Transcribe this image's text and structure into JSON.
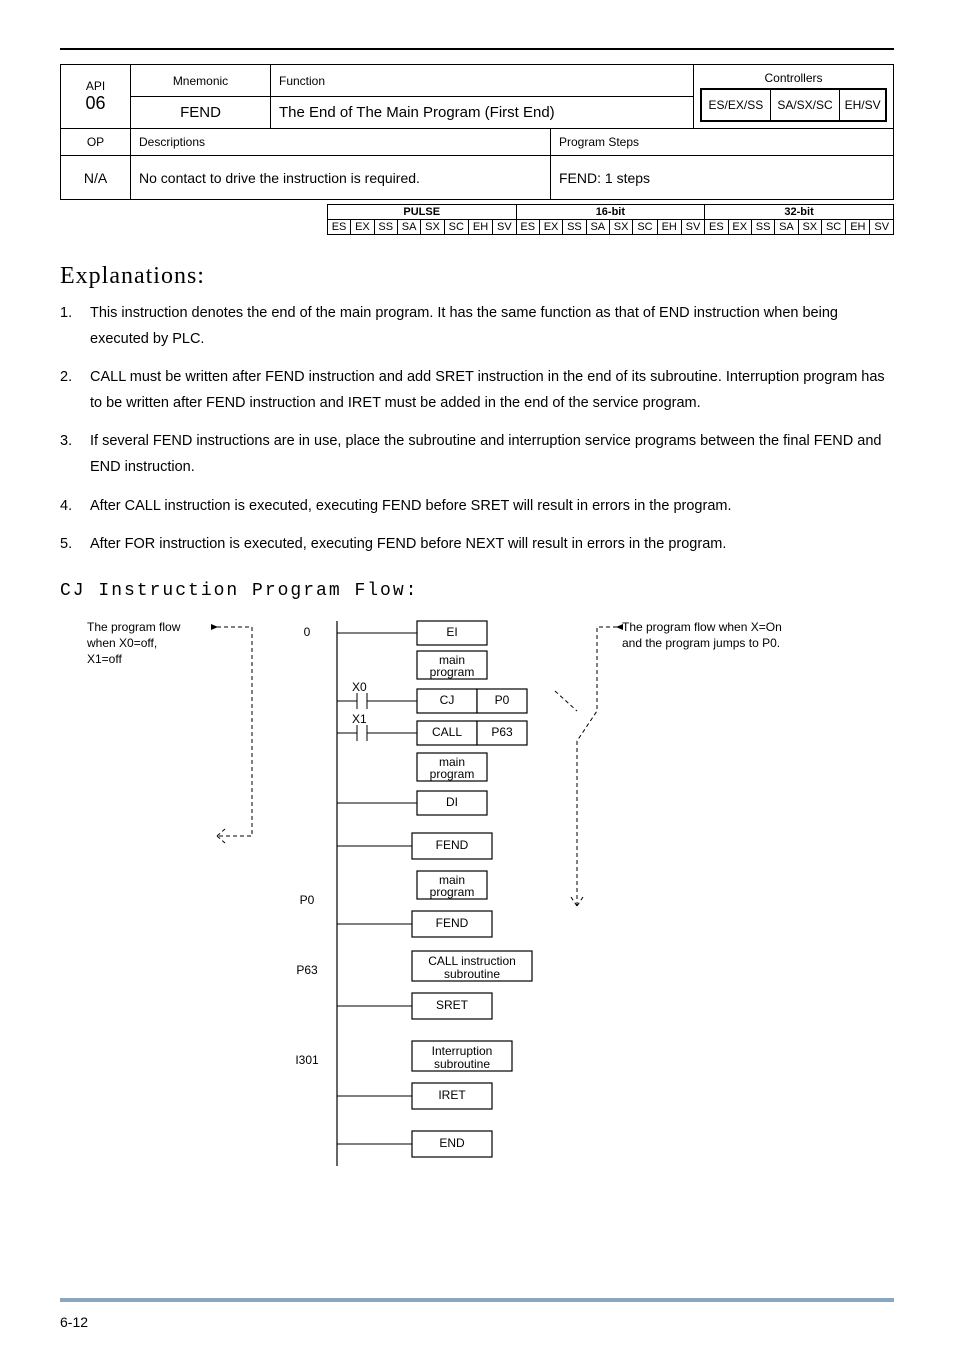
{
  "header": {
    "api": "API",
    "api_num": "06",
    "mnemonic": "Mnemonic",
    "mnemonic_val": "FEND",
    "function": "Function",
    "function_val": "The End of The Main Program (First End)",
    "controllers": "Controllers",
    "ctrl_a": "ES/EX/SS",
    "ctrl_b": "SA/SX/SC",
    "ctrl_c": "EH/SV"
  },
  "operands": {
    "op": "OP",
    "op_val": "N/A",
    "desc": "Descriptions",
    "desc_val": "No contact to drive the instruction is required.",
    "steps": "Program Steps",
    "steps_val": "FEND: 1 steps"
  },
  "pulse": {
    "hdr_pulse": "PULSE",
    "hdr_16": "16-bit",
    "hdr_32": "32-bit",
    "cells": [
      "ES",
      "EX",
      "SS",
      "SA",
      "SX",
      "SC",
      "EH",
      "SV",
      "ES",
      "EX",
      "SS",
      "SA",
      "SX",
      "SC",
      "EH",
      "SV",
      "ES",
      "EX",
      "SS",
      "SA",
      "SX",
      "SC",
      "EH",
      "SV"
    ]
  },
  "labels": {
    "explanations": "Explanations:",
    "cj": "CJ Instruction Program Flow:"
  },
  "expl": {
    "n1": "1.",
    "t1": "This instruction denotes the end of the main program. It has the same function as that of END instruction when being executed by PLC.",
    "n2": "2.",
    "t2": "CALL must be written after FEND instruction and add SRET instruction in the end of its subroutine. Interruption program has to be written after FEND instruction and IRET must be added in the end of the service program.",
    "n3": "3.",
    "t3": "If several FEND instructions are in use, place the subroutine and interruption service programs between the final FEND and END instruction.",
    "n4": "4.",
    "t4": "After CALL instruction is executed, executing FEND before SRET will result in errors in the program.",
    "n5": "5.",
    "t5": "After FOR instruction is executed, executing FEND before NEXT will result in errors in the program."
  },
  "flow": {
    "left_text_a": "The program flow",
    "left_text_b": "when X0=off,",
    "left_text_c": "X1=off",
    "right_text_a": "The program flow when X=On",
    "right_text_b": "and the program jumps to P0.",
    "zero": "0",
    "p0": "P0",
    "p63": "P63",
    "i301": "I301",
    "x0": "X0",
    "x1": "X1",
    "main_program": "main\nprogram",
    "ei": "EI",
    "cj": "CJ",
    "cj_p0": "P0",
    "call": "CALL",
    "call_p63": "P63",
    "di": "DI",
    "fend": "FEND",
    "call_sub": "CALL instruction\nsubroutine",
    "sret": "SRET",
    "int_sub": "Interruption\nsubroutine",
    "iret": "IRET",
    "end": "END"
  },
  "footer": {
    "page": "6-12"
  }
}
